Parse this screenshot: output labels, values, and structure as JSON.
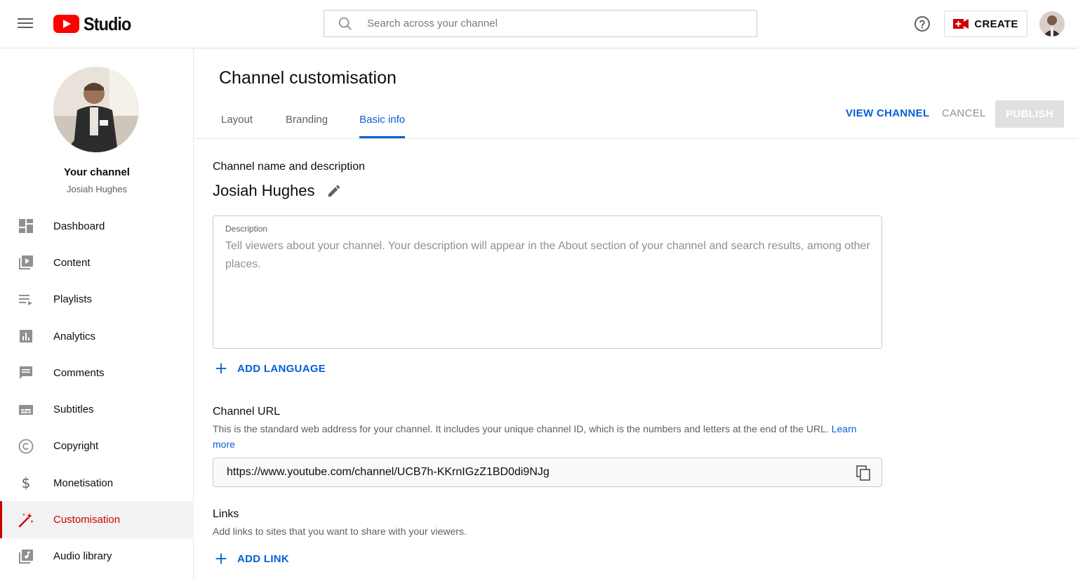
{
  "header": {
    "brand": "Studio",
    "search_placeholder": "Search across your channel",
    "create_label": "CREATE",
    "icons": [
      "menu-icon",
      "search-icon",
      "help-icon",
      "camera-icon"
    ]
  },
  "sidebar": {
    "channel_title": "Your channel",
    "channel_owner": "Josiah Hughes",
    "items": [
      {
        "label": "Dashboard",
        "icon": "dashboard-icon"
      },
      {
        "label": "Content",
        "icon": "content-icon"
      },
      {
        "label": "Playlists",
        "icon": "playlists-icon"
      },
      {
        "label": "Analytics",
        "icon": "analytics-icon"
      },
      {
        "label": "Comments",
        "icon": "comments-icon"
      },
      {
        "label": "Subtitles",
        "icon": "subtitles-icon"
      },
      {
        "label": "Copyright",
        "icon": "copyright-icon"
      },
      {
        "label": "Monetisation",
        "icon": "dollar-icon"
      },
      {
        "label": "Customisation",
        "icon": "magic-wand-icon",
        "active": true
      },
      {
        "label": "Audio library",
        "icon": "audio-library-icon"
      }
    ]
  },
  "main": {
    "page_title": "Channel customisation",
    "tabs": [
      {
        "label": "Layout"
      },
      {
        "label": "Branding"
      },
      {
        "label": "Basic info",
        "active": true
      }
    ],
    "view_channel_label": "VIEW CHANNEL",
    "cancel_label": "CANCEL",
    "publish_label": "PUBLISH",
    "name_section": {
      "title": "Channel name and description",
      "channel_name": "Josiah Hughes",
      "description_label": "Description",
      "description_placeholder": "Tell viewers about your channel. Your description will appear in the About section of your channel and search results, among other places.",
      "add_language_label": "ADD LANGUAGE"
    },
    "url_section": {
      "title": "Channel URL",
      "help_text": "This is the standard web address for your channel. It includes your unique channel ID, which is the numbers and letters at the end of the URL.",
      "learn_more": "Learn more",
      "url": "https://www.youtube.com/channel/UCB7h-KKrnIGzZ1BD0di9NJg"
    },
    "links_section": {
      "title": "Links",
      "help_text": "Add links to sites that you want to share with your viewers.",
      "add_link_label": "ADD LINK"
    }
  },
  "colors": {
    "accent_blue": "#065fd4",
    "brand_red": "#ff0000",
    "active_red": "#cc0000",
    "disabled_gray": "#e0e0e0"
  }
}
